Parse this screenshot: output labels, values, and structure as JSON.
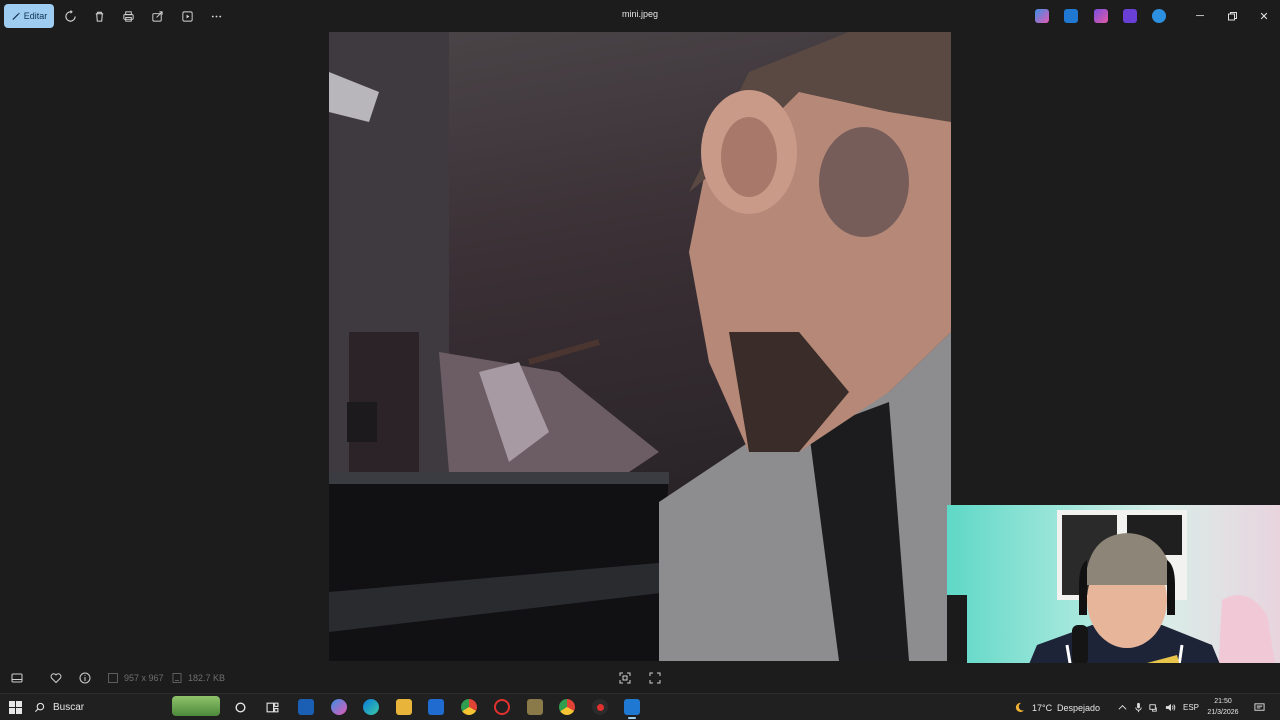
{
  "toolbar": {
    "edit_label": "Editar",
    "file_title": "mini.jpeg",
    "accent": "#9fcdf2"
  },
  "photo": {
    "description_icon": "image-content"
  },
  "statusbar": {
    "dimensions": "957 x 967",
    "file_size": "182.7 KB"
  },
  "taskbar": {
    "search_placeholder": "Buscar",
    "weather_temp": "17°C",
    "weather_desc": "Despejado",
    "language": "ESP",
    "time": "21:50",
    "date": "21/3/2026"
  }
}
